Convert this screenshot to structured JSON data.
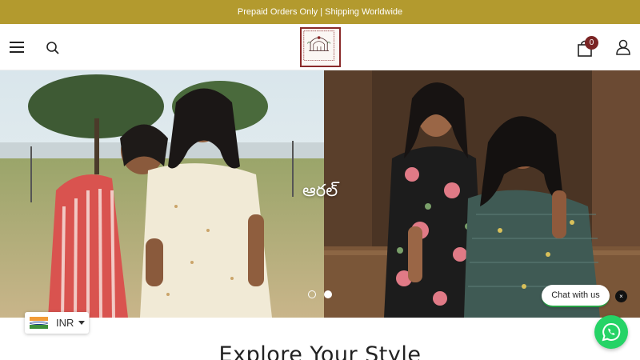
{
  "announcement": {
    "text": "Prepaid Orders Only | Shipping Worldwide"
  },
  "header": {
    "menu_icon": "hamburger-icon",
    "search_icon": "search-icon",
    "logo_text": "AARAL",
    "cart_icon": "shopping-bag-icon",
    "cart_count": "0",
    "account_icon": "user-icon"
  },
  "hero": {
    "title": "ఆరల్",
    "slides": 2,
    "active_slide": 2
  },
  "currency": {
    "code": "INR",
    "flag": "india-flag"
  },
  "chat": {
    "label": "Chat with us",
    "close_symbol": "×"
  },
  "section": {
    "title": "Explore Your Style"
  },
  "colors": {
    "announcement_bg": "#b39a2e",
    "logo_border": "#8a2a2a",
    "cart_badge": "#7a2424",
    "whatsapp": "#25d366"
  }
}
